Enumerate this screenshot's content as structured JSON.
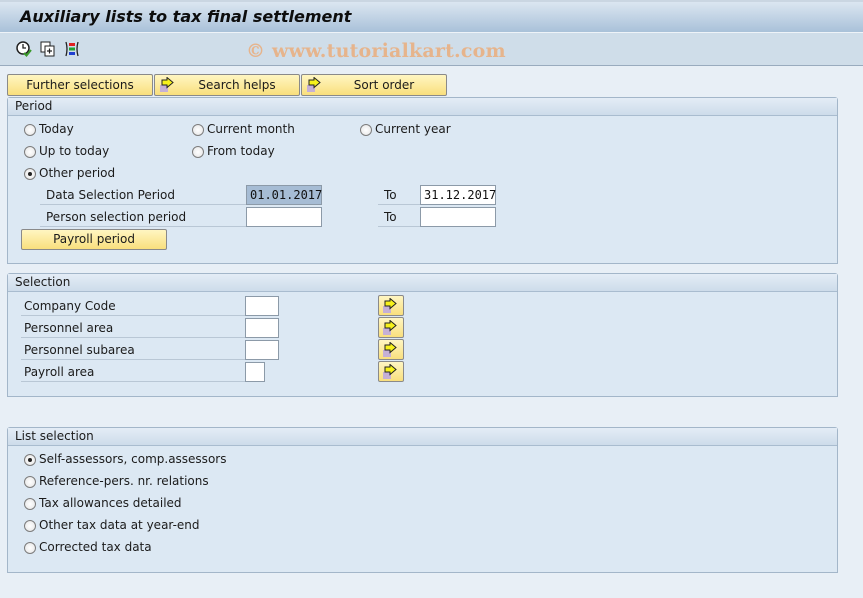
{
  "window": {
    "title": "Auxiliary lists to tax final settlement",
    "watermark": "© www.tutorialkart.com"
  },
  "toolbar": {
    "icons": [
      "execute-clock-icon",
      "get-variant-icon",
      "selection-options-icon"
    ]
  },
  "tab_buttons": [
    {
      "label": "Further selections",
      "icon": null
    },
    {
      "label": "Search helps",
      "icon": "arrow-right-icon"
    },
    {
      "label": "Sort order",
      "icon": "arrow-right-icon"
    }
  ],
  "period": {
    "heading": "Period",
    "radios": [
      {
        "label": "Today",
        "selected": false
      },
      {
        "label": "Current month",
        "selected": false
      },
      {
        "label": "Current year",
        "selected": false
      },
      {
        "label": "Up to today",
        "selected": false
      },
      {
        "label": "From today",
        "selected": false
      },
      {
        "label": "Other period",
        "selected": true
      }
    ],
    "fields": [
      {
        "label": "Data Selection Period",
        "from": "01.01.2017",
        "to_label": "To",
        "to": "31.12.2017"
      },
      {
        "label": "Person selection period",
        "from": "",
        "to_label": "To",
        "to": ""
      }
    ],
    "payroll_button": "Payroll period"
  },
  "selection": {
    "heading": "Selection",
    "fields": [
      {
        "label": "Company Code",
        "value": ""
      },
      {
        "label": "Personnel area",
        "value": ""
      },
      {
        "label": "Personnel subarea",
        "value": ""
      },
      {
        "label": "Payroll area",
        "value": ""
      }
    ]
  },
  "list_selection": {
    "heading": "List selection",
    "radios": [
      {
        "label": "Self-assessors, comp.assessors",
        "selected": true
      },
      {
        "label": "Reference-pers. nr. relations",
        "selected": false
      },
      {
        "label": "Tax allowances detailed",
        "selected": false
      },
      {
        "label": "Other tax data at year-end",
        "selected": false
      },
      {
        "label": "Corrected tax data",
        "selected": false
      }
    ]
  }
}
